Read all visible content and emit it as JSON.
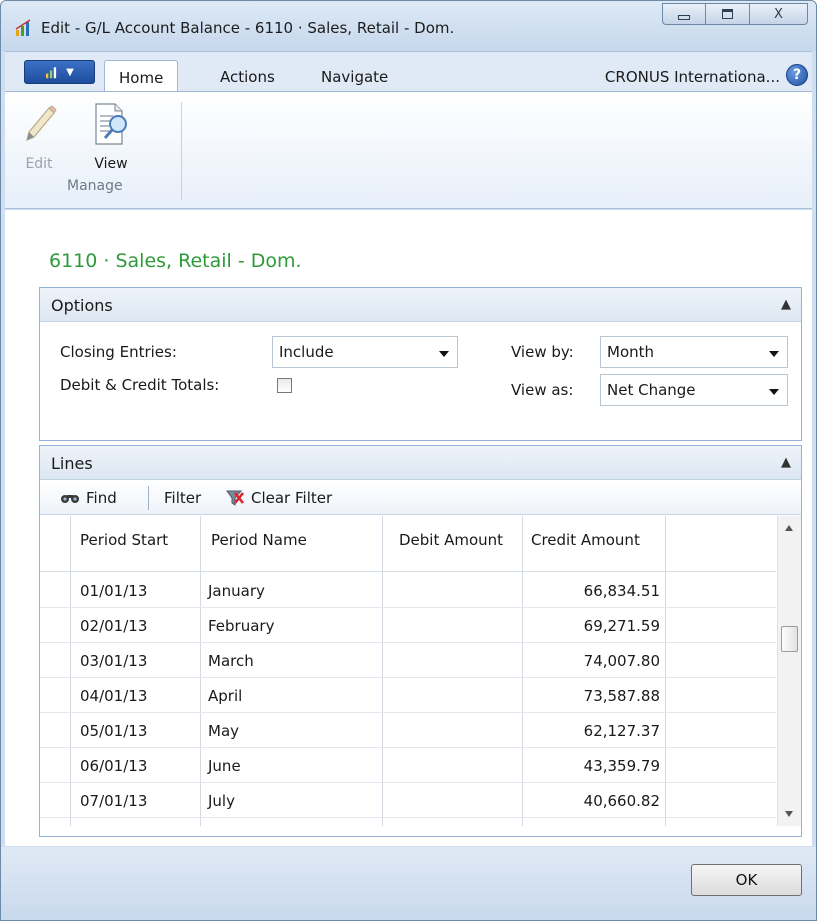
{
  "window": {
    "title": "Edit - G/L Account Balance - 6110 · Sales, Retail - Dom.",
    "controls": {
      "minimize": "minimize",
      "maximize": "maximize",
      "close": "X"
    }
  },
  "ribbon": {
    "tabs": [
      {
        "label": "Home",
        "active": true
      },
      {
        "label": "Actions",
        "active": false
      },
      {
        "label": "Navigate",
        "active": false
      }
    ],
    "company": "CRONUS Internationa...",
    "help_icon": "?",
    "buttons": [
      {
        "label": "Edit",
        "icon": "pencil-icon",
        "enabled": false
      },
      {
        "label": "View",
        "icon": "view-document-icon",
        "enabled": true
      }
    ],
    "group_label": "Manage"
  },
  "page": {
    "title": "6110 · Sales, Retail - Dom."
  },
  "options": {
    "header": "Options",
    "closing_entries_label": "Closing Entries:",
    "closing_entries_value": "Include",
    "debit_credit_totals_label": "Debit & Credit Totals:",
    "debit_credit_totals_checked": false,
    "view_by_label": "View by:",
    "view_by_value": "Month",
    "view_as_label": "View as:",
    "view_as_value": "Net Change"
  },
  "lines": {
    "header": "Lines",
    "toolbar": {
      "find": "Find",
      "filter": "Filter",
      "clear_filter": "Clear Filter"
    },
    "columns": [
      "Period Start",
      "Period Name",
      "Debit Amount",
      "Credit Amount"
    ],
    "rows": [
      {
        "period_start": "01/01/13",
        "period_name": "January",
        "debit": "",
        "credit": "66,834.51"
      },
      {
        "period_start": "02/01/13",
        "period_name": "February",
        "debit": "",
        "credit": "69,271.59"
      },
      {
        "period_start": "03/01/13",
        "period_name": "March",
        "debit": "",
        "credit": "74,007.80"
      },
      {
        "period_start": "04/01/13",
        "period_name": "April",
        "debit": "",
        "credit": "73,587.88"
      },
      {
        "period_start": "05/01/13",
        "period_name": "May",
        "debit": "",
        "credit": "62,127.37"
      },
      {
        "period_start": "06/01/13",
        "period_name": "June",
        "debit": "",
        "credit": "43,359.79"
      },
      {
        "period_start": "07/01/13",
        "period_name": "July",
        "debit": "",
        "credit": "40,660.82"
      }
    ]
  },
  "footer": {
    "ok_label": "OK"
  },
  "colors": {
    "title_green": "#2f9a3a",
    "accent_blue": "#1f4d9c",
    "frame": "#cfdff0"
  }
}
